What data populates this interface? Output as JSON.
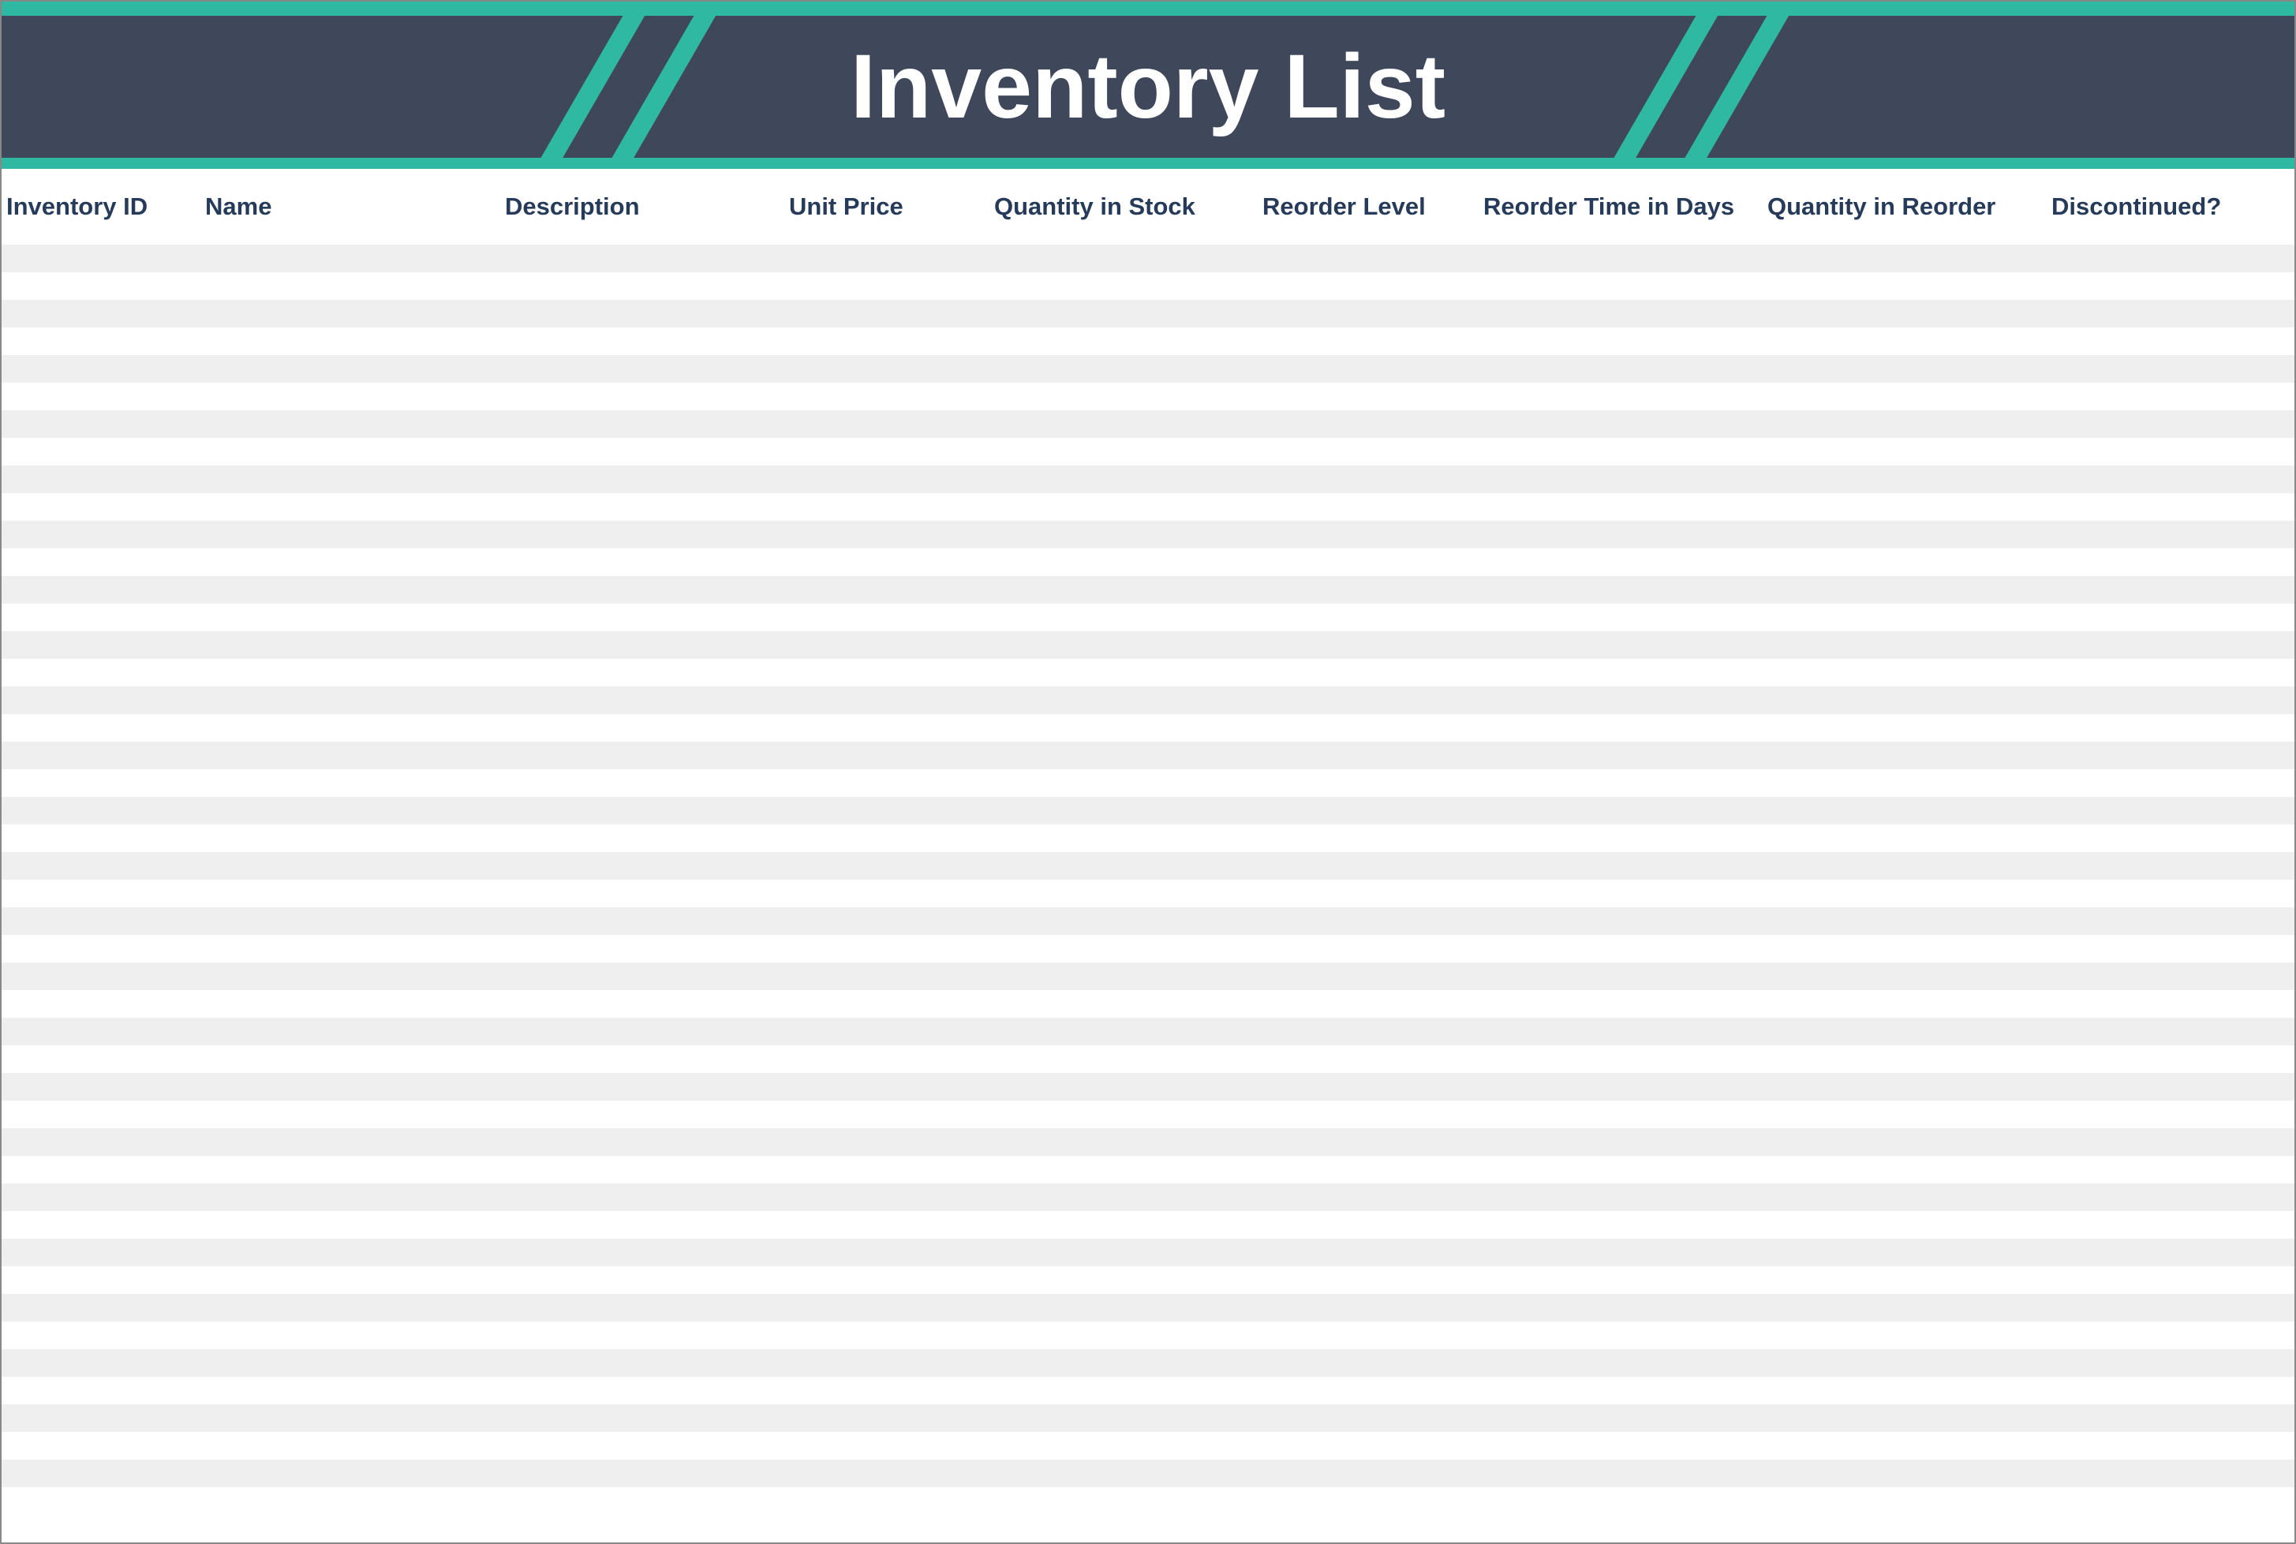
{
  "header": {
    "title": "Inventory List"
  },
  "columns": {
    "inventory_id": "Inventory ID",
    "name": "Name",
    "description": "Description",
    "unit_price": "Unit Price",
    "quantity_in_stock": "Quantity in Stock",
    "reorder_level": "Reorder Level",
    "reorder_time_in_days": "Reorder Time in Days",
    "quantity_in_reorder": "Quantity in Reorder",
    "discontinued": "Discontinued?"
  },
  "rows": [
    {},
    {},
    {},
    {},
    {},
    {},
    {},
    {},
    {},
    {},
    {},
    {},
    {},
    {},
    {},
    {},
    {},
    {},
    {},
    {},
    {},
    {},
    {},
    {},
    {},
    {},
    {},
    {},
    {},
    {},
    {},
    {},
    {},
    {},
    {},
    {},
    {},
    {},
    {},
    {},
    {},
    {},
    {},
    {},
    {},
    {}
  ],
  "colors": {
    "accent_teal": "#2fb9a3",
    "header_dark": "#3f475a",
    "row_stripe": "#efefef",
    "text_header": "#263a5a"
  }
}
